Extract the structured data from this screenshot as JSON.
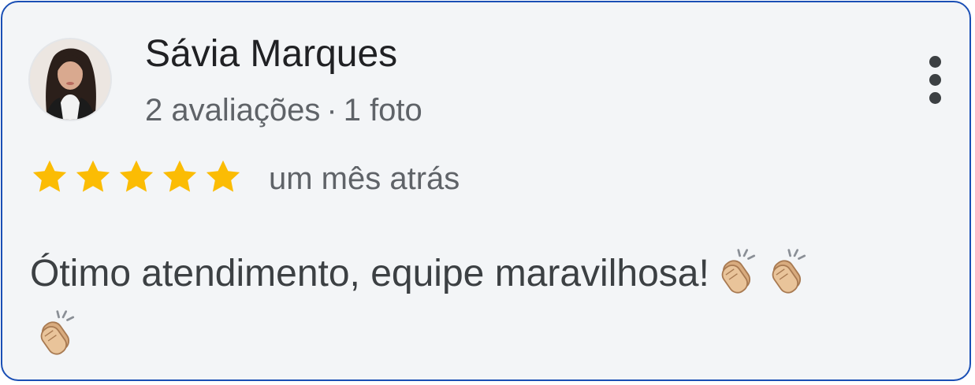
{
  "review": {
    "author": {
      "name": "Sávia Marques",
      "reviews_count": "2 avaliações",
      "separator": "·",
      "photos_count": "1 foto",
      "avatar_icon": "profile-photo"
    },
    "rating": 5,
    "max_rating": 5,
    "date": "um mês atrás",
    "text": "Ótimo atendimento, equipe maravilhosa!",
    "emojis": [
      "clapping-hands",
      "clapping-hands",
      "clapping-hands"
    ],
    "more_icon": "more-vert-icon"
  },
  "colors": {
    "card_background": "#f3f5f7",
    "card_border": "#1a4fb5",
    "star": "#fbbc04",
    "name_text": "#202124",
    "meta_text": "#5f6368",
    "body_text": "#3c4043"
  }
}
